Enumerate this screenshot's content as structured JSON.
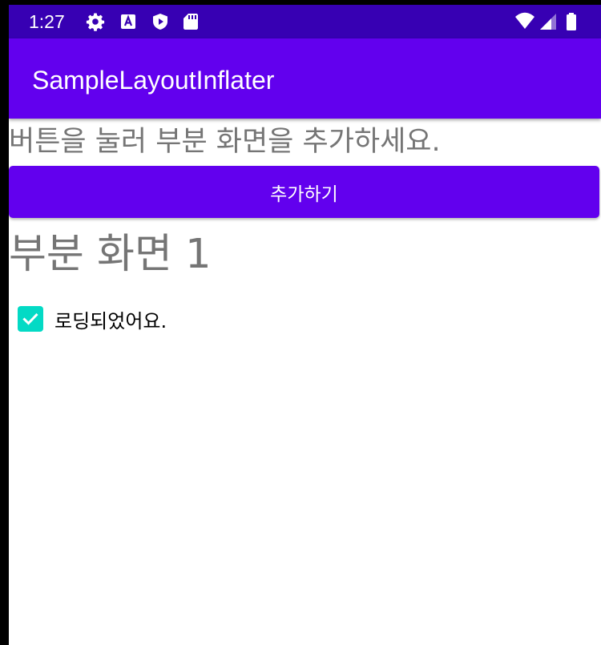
{
  "status_bar": {
    "time": "1:27",
    "icons_left": [
      "gear-icon",
      "font-a-icon",
      "play-shield-icon",
      "sd-card-icon"
    ],
    "icons_right": [
      "wifi-icon",
      "signal-icon",
      "battery-icon"
    ],
    "background": "#3700b3"
  },
  "app_bar": {
    "title": "SampleLayoutInflater",
    "background": "#6200ee"
  },
  "main": {
    "instruction": "버튼을 눌러 부분 화면을 추가하세요.",
    "add_button_label": "추가하기",
    "sub_layout": {
      "title": "부분 화면 1",
      "checkbox_label": "로딩되었어요.",
      "checkbox_checked": true,
      "checkbox_color": "#03dac5"
    }
  }
}
